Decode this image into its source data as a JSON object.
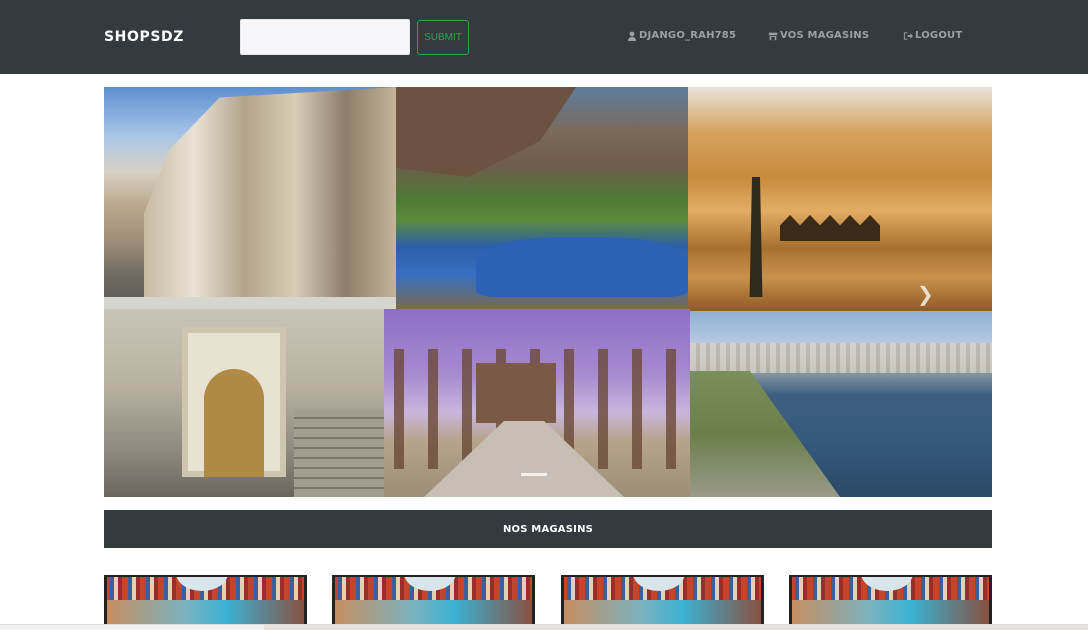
{
  "navbar": {
    "brand": "SHOPSDZ",
    "search": {
      "value": "",
      "placeholder": ""
    },
    "submit_label": "SUBMIT",
    "links": [
      {
        "label": "DJANGO_RAH785",
        "icon": "user-icon"
      },
      {
        "label": "VOS MAGASINS",
        "icon": "store-icon"
      },
      {
        "label": "LOGOUT",
        "icon": "logout-icon"
      }
    ]
  },
  "carousel": {
    "tiles": [
      "hot-springs-cliff",
      "oasis-pond",
      "desert-camels",
      "casbah-fountain",
      "roman-ruins",
      "harbor-city"
    ],
    "next_icon": "chevron-right-icon",
    "active_indicator": 1
  },
  "stores_section": {
    "title": "NOS MAGASINS",
    "card_count": 4
  },
  "colors": {
    "navbar_bg": "#343a40",
    "submit_accent": "#28a745",
    "nav_link_text": "#9aa0a6"
  }
}
